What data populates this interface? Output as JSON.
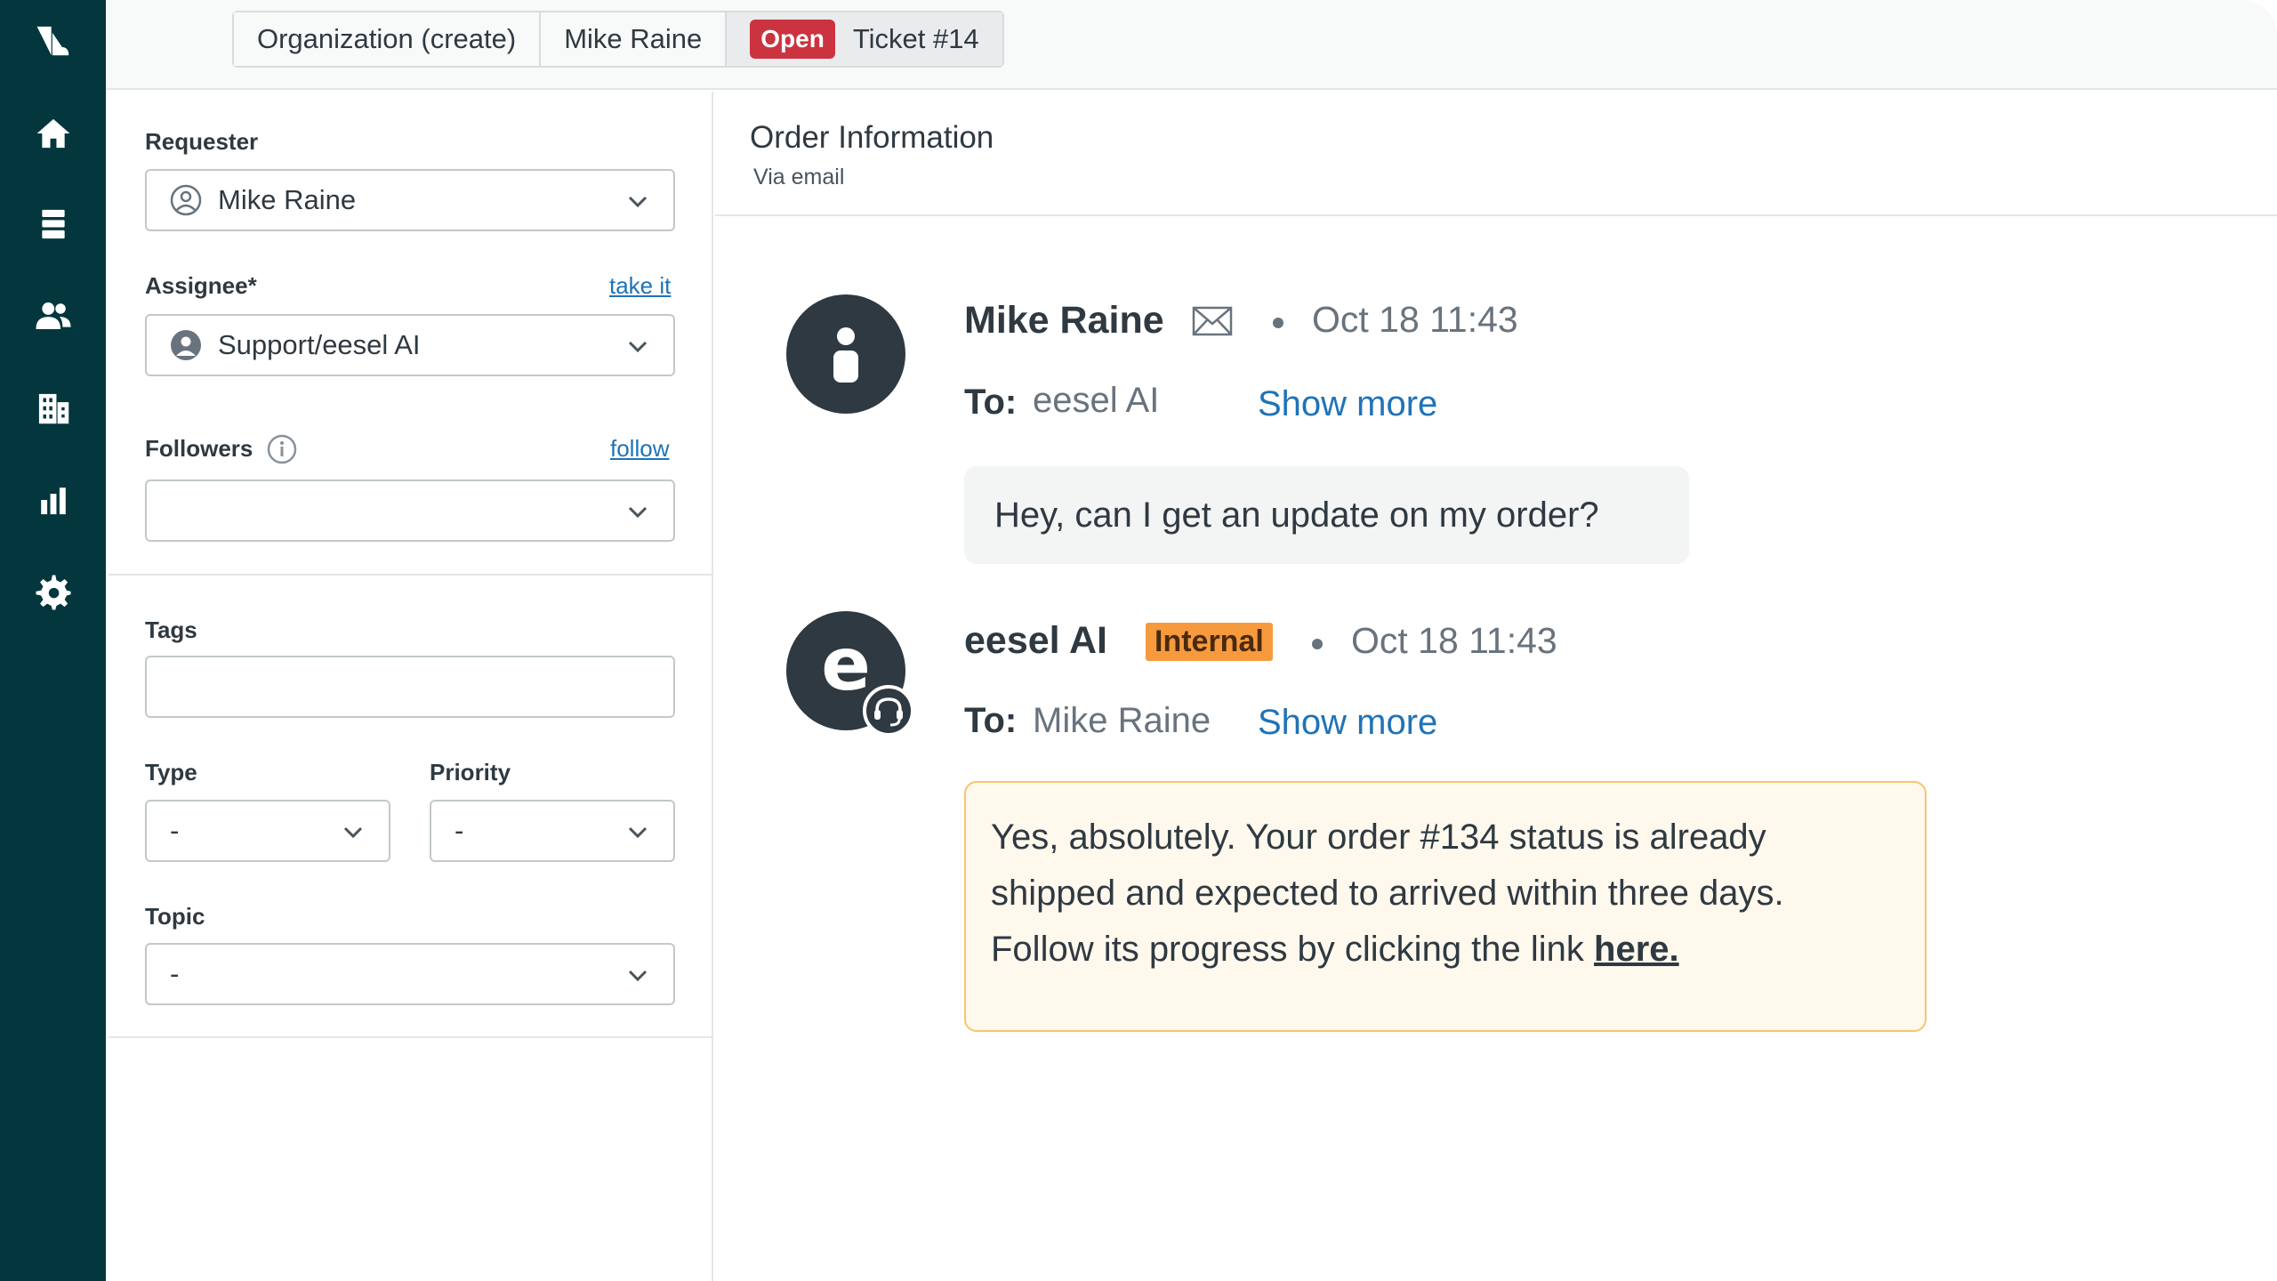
{
  "colors": {
    "nav_bg": "#03363d",
    "status_open": "#cc3340",
    "internal_badge": "#f79a3e",
    "link": "#1f73b7",
    "note_bg": "#fff8ed",
    "note_border": "#f5c66e"
  },
  "nav": {
    "items": [
      {
        "icon": "zendesk-logo-icon"
      },
      {
        "icon": "home-icon"
      },
      {
        "icon": "views-icon"
      },
      {
        "icon": "customers-icon"
      },
      {
        "icon": "organizations-icon"
      },
      {
        "icon": "reporting-icon"
      },
      {
        "icon": "settings-icon"
      }
    ]
  },
  "tabs": {
    "organization": "Organization (create)",
    "user": "Mike Raine",
    "ticket_status": "Open",
    "ticket": "Ticket #14"
  },
  "properties": {
    "requester": {
      "label": "Requester",
      "value": "Mike Raine"
    },
    "assignee": {
      "label": "Assignee*",
      "action": "take it",
      "value": "Support/eesel AI"
    },
    "followers": {
      "label": "Followers",
      "action": "follow",
      "value": ""
    },
    "tags": {
      "label": "Tags",
      "value": ""
    },
    "type": {
      "label": "Type",
      "value": "-"
    },
    "priority": {
      "label": "Priority",
      "value": "-"
    },
    "topic": {
      "label": "Topic",
      "value": "-"
    }
  },
  "conversation": {
    "subject": "Order Information",
    "channel": "Via email",
    "messages": [
      {
        "author": "Mike Raine",
        "timestamp": "Oct 18 11:43",
        "to_label": "To:",
        "to": "eesel AI",
        "show_more": "Show more",
        "body": "Hey, can I get an update on my order?"
      },
      {
        "author": "eesel AI",
        "badge": "Internal",
        "avatar_letter": "e",
        "timestamp": "Oct 18 11:43",
        "to_label": "To:",
        "to": "Mike Raine",
        "show_more": "Show more",
        "body_line1": "Yes, absolutely. Your order #134 status is already",
        "body_line2": "shipped and expected to arrived within three days.",
        "body_line3": "Follow its progress by clicking the link ",
        "link_text": "here."
      }
    ]
  }
}
